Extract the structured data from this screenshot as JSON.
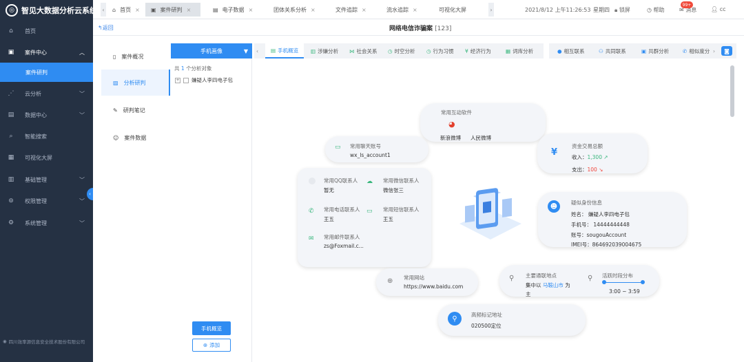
{
  "app": {
    "title": "智见大数据分析云系统"
  },
  "sidebar": {
    "items": [
      {
        "label": "首页",
        "icon": "home-icon"
      },
      {
        "label": "案件中心",
        "icon": "case-icon"
      },
      {
        "label": "案件研判",
        "icon": ""
      },
      {
        "label": "云分析",
        "icon": "cloud-icon"
      },
      {
        "label": "数据中心",
        "icon": "database-icon"
      },
      {
        "label": "智能搜索",
        "icon": "search-icon"
      },
      {
        "label": "可视化大屏",
        "icon": "screen-icon"
      },
      {
        "label": "基础管理",
        "icon": "grid-icon"
      },
      {
        "label": "权限管理",
        "icon": "lock-icon"
      },
      {
        "label": "系统管理",
        "icon": "gear-icon"
      }
    ],
    "copyright": "四川效率源信息安全技术股份有限公司"
  },
  "topbar": {
    "tabs": [
      "首页",
      "案件研判",
      "电子数据",
      "团体关系分析",
      "文件追踪",
      "流水追踪",
      "可视化大屏"
    ],
    "datetime": "2021/8/12 上午11:26:53",
    "weekday": "星期四",
    "lock": "锁屏",
    "help": "帮助",
    "message": "消息",
    "badge": "99+",
    "user": "cc"
  },
  "header": {
    "back": "返回",
    "title": "网络电信诈骗案",
    "count": "[123]"
  },
  "left_panel": {
    "items": [
      "案件概况",
      "分析研判",
      "研判笔记",
      "案件数据"
    ]
  },
  "mid_panel": {
    "head": "手机画像",
    "count_prefix": "共",
    "count": "1",
    "count_suffix": "个分析对象",
    "node": "嫌疑人李四电子包",
    "primary_btn": "手机概览",
    "add_btn": "添加"
  },
  "subtabs": [
    "手机概览",
    "涉嫌分析",
    "社会关系",
    "时空分析",
    "行为习惯",
    "经济行为",
    "词库分析",
    "相互联系",
    "共同联系",
    "共群分析",
    "相似度分"
  ],
  "cards": {
    "apps": {
      "title": "常用互动软件",
      "a1": "新浪微博",
      "a2": "人民微博"
    },
    "chat": {
      "title": "常用聊天账号",
      "value": "wx_ls_account1"
    },
    "money": {
      "title": "资金交易总额",
      "in_label": "收入：",
      "in_value": "1,300",
      "out_label": "支出：",
      "out_value": "100"
    },
    "contacts": {
      "qq_t": "常用QQ联系人",
      "qq_v": "暂无",
      "wx_t": "常用微信联系人",
      "wx_v": "微信张三",
      "tel_t": "常用电话联系人",
      "tel_v": "王五",
      "sms_t": "常用短信联系人",
      "sms_v": "王五",
      "mail_t": "常用邮件联系人",
      "mail_v": "zs@Foxmail.c..."
    },
    "identity": {
      "title": "疑似身份信息",
      "name": "姓名： 嫌疑人李四电子包",
      "phone": "手机号： 14444444448",
      "account": "账号：sougouAccount",
      "imei": "IMEI号：864692039004675"
    },
    "site": {
      "title": "常用网站",
      "value": "https://www.baidu.com"
    },
    "location": {
      "title": "主要通联地点",
      "v1": "集中以",
      "city": "马鞍山市",
      "v2": "为",
      "v3": "主"
    },
    "active": {
      "title": "活跃时段分布",
      "value": "3:00 ~ 3:59"
    },
    "geo": {
      "title": "高频标记地址",
      "value": "020500定位"
    }
  }
}
